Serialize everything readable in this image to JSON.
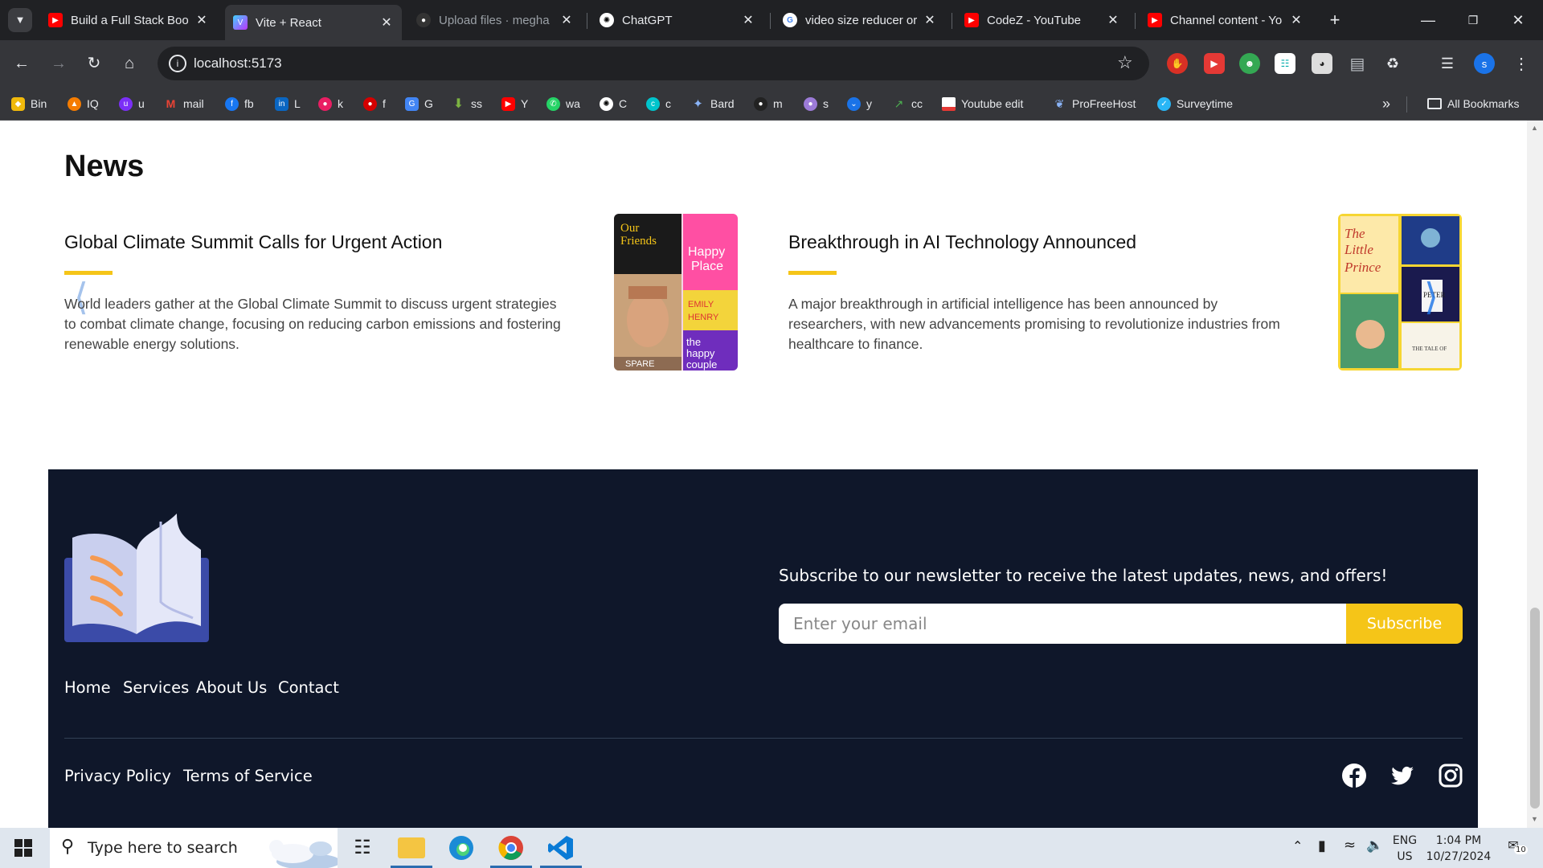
{
  "browser": {
    "tabs": [
      {
        "title": "Build a Full Stack Boo",
        "icon": "youtube-icon"
      },
      {
        "title": "Vite + React",
        "icon": "vite-icon",
        "active": true
      },
      {
        "title": "Upload files · megha",
        "icon": "github-icon"
      },
      {
        "title": "ChatGPT",
        "icon": "chatgpt-icon"
      },
      {
        "title": "video size reducer or",
        "icon": "google-icon"
      },
      {
        "title": "CodeZ - YouTube",
        "icon": "youtube-icon"
      },
      {
        "title": "Channel content - Yo",
        "icon": "youtube-icon"
      }
    ],
    "url": "localhost:5173",
    "bookmarks": [
      {
        "label": "Bin"
      },
      {
        "label": "IQ"
      },
      {
        "label": "u"
      },
      {
        "label": "mail"
      },
      {
        "label": "fb"
      },
      {
        "label": "L"
      },
      {
        "label": "k"
      },
      {
        "label": "f"
      },
      {
        "label": "G"
      },
      {
        "label": "ss"
      },
      {
        "label": "Y"
      },
      {
        "label": "wa"
      },
      {
        "label": "C"
      },
      {
        "label": "c"
      },
      {
        "label": "Bard"
      },
      {
        "label": "m"
      },
      {
        "label": "s"
      },
      {
        "label": "y"
      },
      {
        "label": "cc"
      },
      {
        "label": "Youtube edit"
      },
      {
        "label": "ProFreeHost"
      },
      {
        "label": "Surveytime"
      }
    ],
    "all_bookmarks": "All Bookmarks",
    "profile_initial": "s"
  },
  "news": {
    "heading": "News",
    "cards": [
      {
        "title": "Global Climate Summit Calls for Urgent Action",
        "description": "World leaders gather at the Global Climate Summit to discuss urgent strategies to combat climate change, focusing on reducing carbon emissions and fostering renewable energy solutions."
      },
      {
        "title": "Breakthrough in AI Technology Announced",
        "description": "A major breakthrough in artificial intelligence has been announced by researchers, with new advancements promising to revolutionize industries from healthcare to finance."
      }
    ]
  },
  "footer": {
    "newsletter_text": "Subscribe to our newsletter to receive the latest updates, news, and offers!",
    "email_placeholder": "Enter your email",
    "subscribe_label": "Subscribe",
    "nav": [
      "Home",
      "Services",
      "About Us",
      "Contact"
    ],
    "policy": [
      "Privacy Policy",
      "Terms of Service"
    ],
    "social": [
      "facebook-icon",
      "twitter-icon",
      "instagram-icon"
    ]
  },
  "taskbar": {
    "search_placeholder": "Type here to search",
    "lang_top": "ENG",
    "lang_bottom": "US",
    "time": "1:04 PM",
    "date": "10/27/2024",
    "notifications": "10"
  },
  "colors": {
    "accent": "#f5c518",
    "footer_bg": "#0f172a",
    "browser_dark": "#202124",
    "toolbar": "#35363a"
  }
}
